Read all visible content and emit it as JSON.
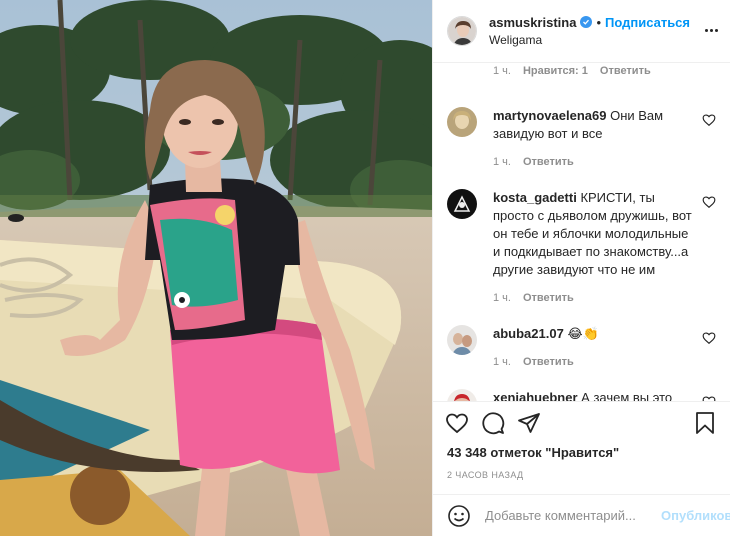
{
  "post": {
    "author": "asmuskristina",
    "follow_label": "Подписаться",
    "separator": "•",
    "location": "Weligama",
    "likes": "43 348 отметок \"Нравится\"",
    "time": "2 ЧАСОВ НАЗАД"
  },
  "top_meta": {
    "time": "1 ч.",
    "likes": "Нравится: 1",
    "reply": "Ответить"
  },
  "comments": [
    {
      "user": "martynovaelena69",
      "text": "Они Вам завидую вот и все",
      "time": "1 ч.",
      "reply": "Ответить"
    },
    {
      "user": "kosta_gadetti",
      "text": "КРИСТИ, ты просто с дьяволом дружишь, вот он тебе и яблочки молодильные и подкидывает по знакомству...а другие завидуют что не им",
      "time": "1 ч.",
      "reply": "Ответить"
    },
    {
      "user": "abuba21.07",
      "text": "😂👏",
      "time": "1 ч.",
      "reply": "Ответить"
    },
    {
      "user": "xeniahuebner",
      "text": "А зачем вы это"
    }
  ],
  "add_comment": {
    "placeholder": "Добавьте комментарий...",
    "publish": "Опубликовать"
  },
  "colors": {
    "accent": "#0095f6",
    "publish_disabled": "#b2dffc",
    "muted": "#8e8e8e"
  },
  "icons": [
    "heart-icon",
    "comment-icon",
    "share-icon",
    "bookmark-icon",
    "emoji-icon",
    "more-icon",
    "verified-icon"
  ]
}
